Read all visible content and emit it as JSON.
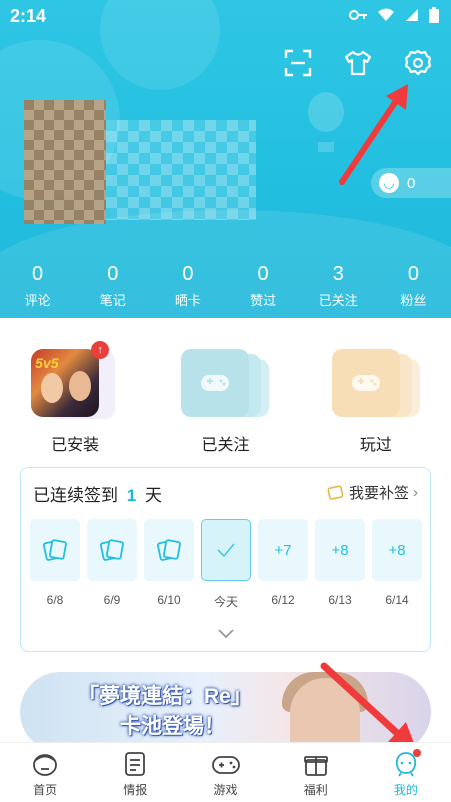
{
  "status_bar": {
    "time": "2:14"
  },
  "header": {
    "top_actions": [
      "scan-icon",
      "outfit-icon",
      "settings-icon"
    ],
    "mood": {
      "count": "0"
    },
    "stats": [
      {
        "value": "0",
        "label": "评论"
      },
      {
        "value": "0",
        "label": "笔记"
      },
      {
        "value": "0",
        "label": "晒卡"
      },
      {
        "value": "0",
        "label": "赞过"
      },
      {
        "value": "3",
        "label": "已关注"
      },
      {
        "value": "0",
        "label": "粉丝"
      }
    ]
  },
  "games": [
    {
      "label": "已安装",
      "app_tag": "5v5",
      "badge": "↑"
    },
    {
      "label": "已关注"
    },
    {
      "label": "玩过"
    }
  ],
  "checkin": {
    "title_prefix": "已连续签到",
    "days_count": "1",
    "title_suffix": "天",
    "makeup_label": "我要补签",
    "days": [
      {
        "date": "6/8",
        "state": "signed"
      },
      {
        "date": "6/9",
        "state": "signed"
      },
      {
        "date": "6/10",
        "state": "signed"
      },
      {
        "date": "今天",
        "state": "today"
      },
      {
        "date": "6/12",
        "reward": "+7"
      },
      {
        "date": "6/13",
        "reward": "+8"
      },
      {
        "date": "6/14",
        "reward": "+8"
      }
    ]
  },
  "banner": {
    "line1": "「夢境連結：Re」",
    "line2": "卡池登場！"
  },
  "bottom_nav": [
    {
      "label": "首页"
    },
    {
      "label": "情报"
    },
    {
      "label": "游戏"
    },
    {
      "label": "福利"
    },
    {
      "label": "我的",
      "active": true
    }
  ],
  "colors": {
    "accent": "#1fb7da",
    "header": "#23bfe0",
    "alert": "#e8413b"
  }
}
